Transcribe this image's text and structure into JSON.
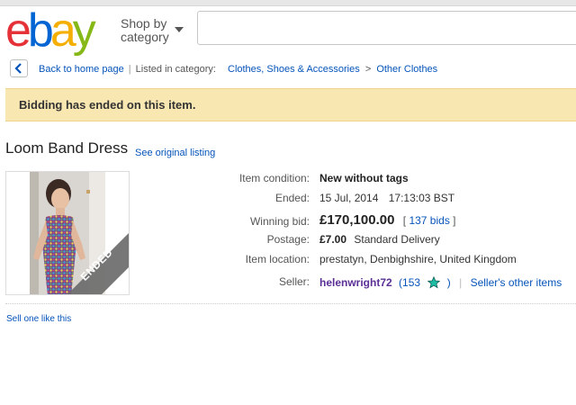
{
  "logo": {
    "letters": [
      "e",
      "b",
      "a",
      "y"
    ],
    "colors": [
      "#e53238",
      "#0064d2",
      "#f5af02",
      "#86b817"
    ]
  },
  "header": {
    "shop_by_line1": "Shop by",
    "shop_by_line2": "category",
    "search_placeholder": ""
  },
  "breadcrumb": {
    "back_label": "Back to home page",
    "listed_in": "Listed in category:",
    "category": "Clothes, Shoes & Accessories",
    "separator": ">",
    "subcategory": "Other Clothes"
  },
  "banner": {
    "text": "Bidding has ended on this item."
  },
  "item": {
    "title": "Loom Band Dress",
    "see_original": "See original listing",
    "image_badge": "ENDED",
    "condition_label": "Item condition:",
    "condition_value": "New without tags",
    "ended_label": "Ended:",
    "ended_date": "15 Jul, 2014",
    "ended_time": "17:13:03 BST",
    "winning_label": "Winning bid:",
    "winning_value": "£170,100.00",
    "bids_open": "[",
    "bids_value": "137 bids",
    "bids_close": "]",
    "postage_label": "Postage:",
    "postage_value": "£7.00",
    "postage_method": "Standard Delivery",
    "location_label": "Item location:",
    "location_value": "prestatyn, Denbighshire, United Kingdom",
    "seller_label": "Seller:",
    "seller_name": "helenwright72",
    "seller_score_open": "(153",
    "seller_score_close": ")",
    "seller_other": "Seller's other items"
  },
  "footer": {
    "sell_one": "Sell one like this"
  },
  "colors": {
    "link": "#0654ba",
    "banner_bg": "#f9e7b2",
    "seller": "#5b3096",
    "star": "#1ebea5"
  }
}
